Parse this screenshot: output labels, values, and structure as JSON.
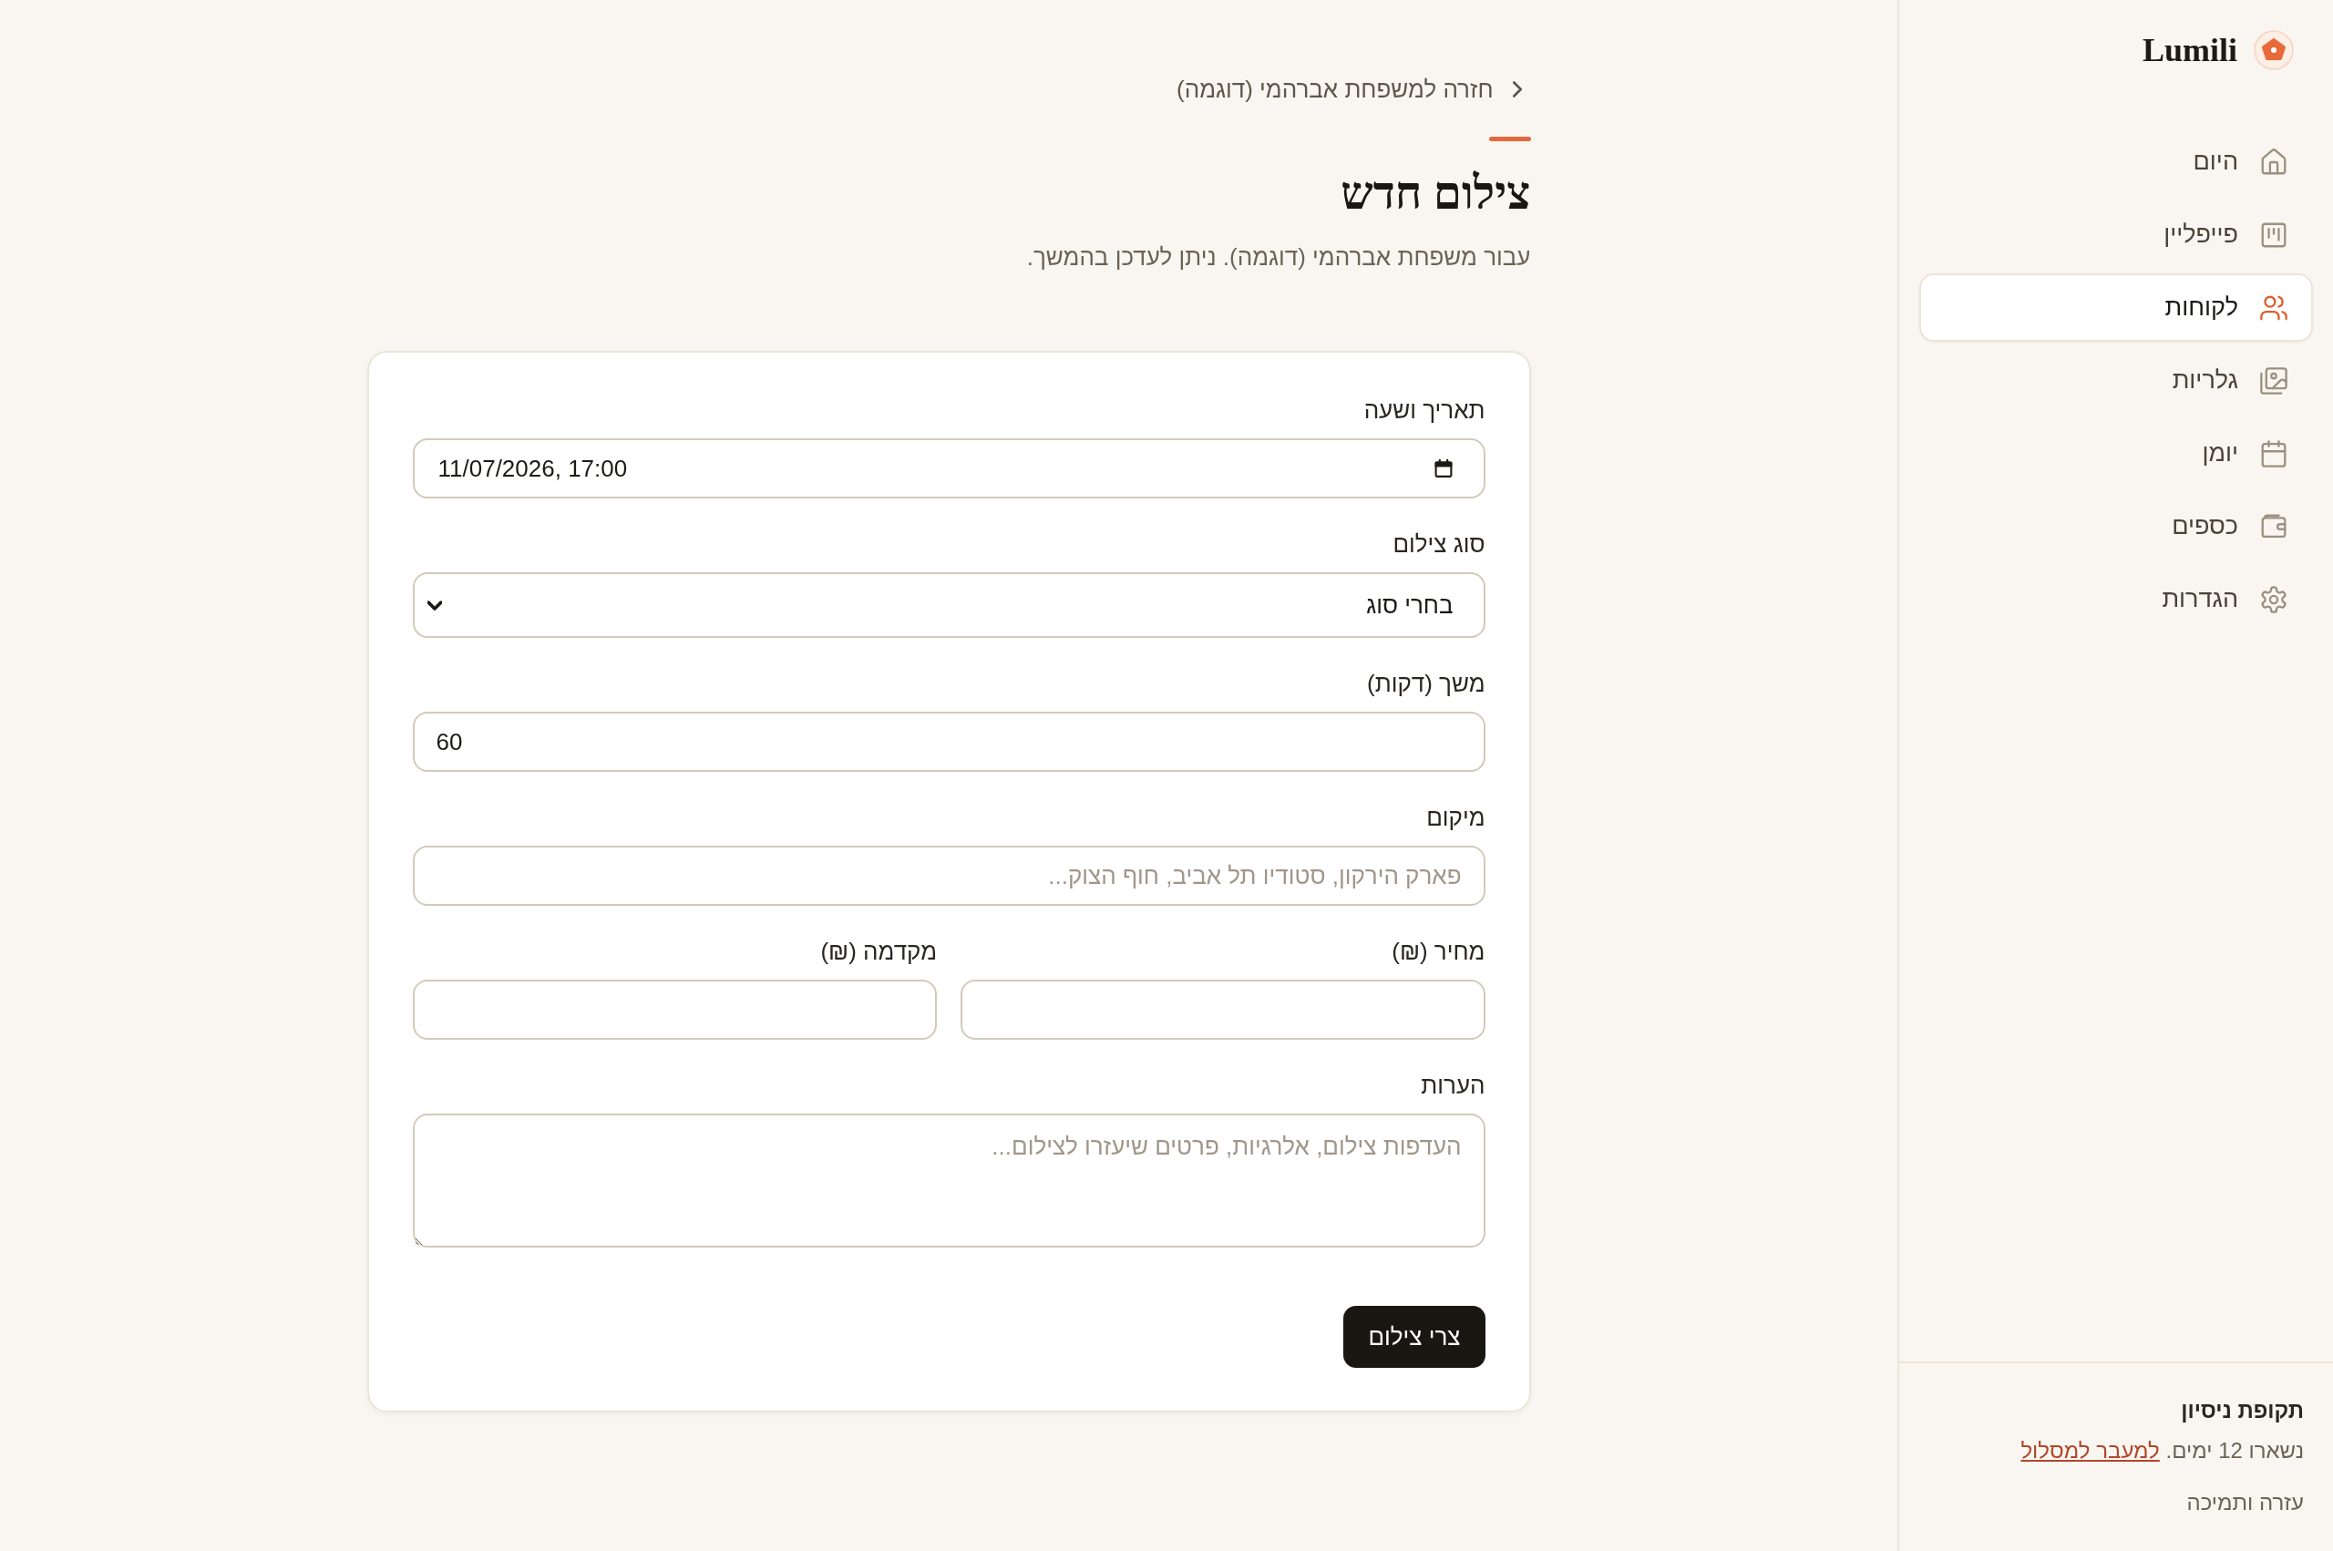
{
  "sidebar": {
    "brand": "Lumili",
    "nav_items": [
      {
        "label": "היום",
        "selected": false
      },
      {
        "label": "פייפליין",
        "selected": false
      },
      {
        "label": "לקוחות",
        "selected": true
      },
      {
        "label": "גלריות",
        "selected": false
      },
      {
        "label": "יומן",
        "selected": false
      },
      {
        "label": "כספים",
        "selected": false
      },
      {
        "label": "הגדרות",
        "selected": false
      }
    ],
    "trial": {
      "title": "תקופת ניסיון",
      "text": "נשארו 12 ימים.",
      "link": "למעבר למסלול"
    },
    "help_link": "עזרה ותמיכה"
  },
  "breadcrumb": {
    "back_link": "חזרה למשפחת אברהמי (דוגמה)"
  },
  "header": {
    "title": "צילום חדש",
    "subtitle": "עבור משפחת אברהמי (דוגמה). ניתן לעדכן בהמשך."
  },
  "form": {
    "fields": [
      {
        "kind": "datetime",
        "label": "תאריך ושעה",
        "value": "11/07/2026, 17:00"
      },
      {
        "kind": "select",
        "label": "סוג צילום",
        "value": "בחרי סוג"
      },
      {
        "kind": "number",
        "label": "משך (דקות)",
        "value": "60"
      },
      {
        "kind": "text",
        "label": "מיקום",
        "placeholder": "פארק הירקון, סטודיו תל אביב, חוף הצוק..."
      },
      {
        "kind": "row",
        "fields": [
          {
            "kind": "text",
            "label": "מחיר (₪)"
          },
          {
            "kind": "text",
            "label": "מקדמה (₪)"
          }
        ]
      },
      {
        "kind": "textarea",
        "label": "הערות",
        "placeholder": "העדפות צילום, אלרגיות, פרטים שיעזרו לצילום..."
      }
    ],
    "submit_button": "צרי צילום"
  }
}
